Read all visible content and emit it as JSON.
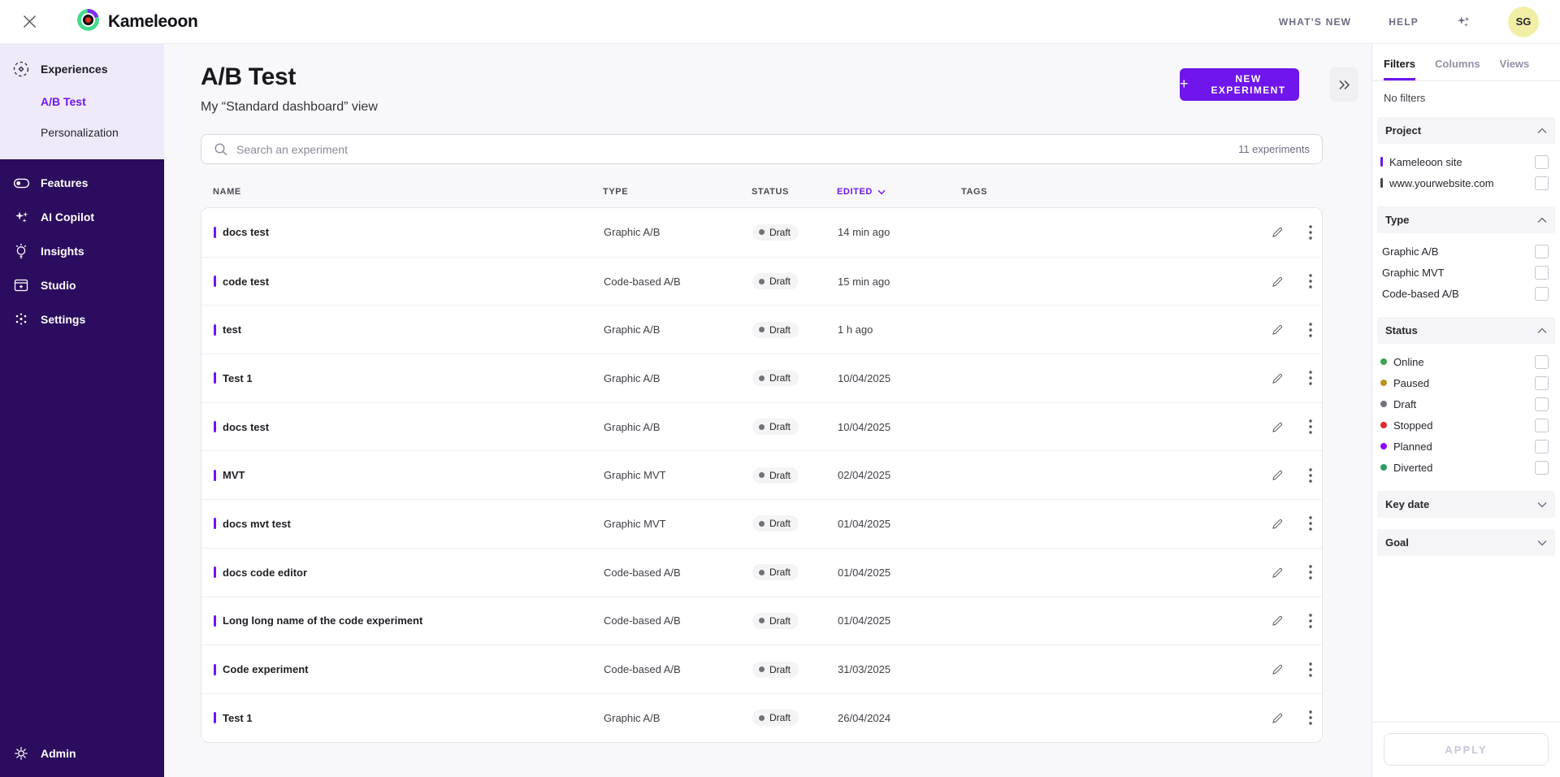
{
  "topbar": {
    "brand": "Kameleoon",
    "whats_new": "WHAT'S NEW",
    "help": "HELP",
    "avatar_initials": "SG"
  },
  "sidebar": {
    "experiences": {
      "label": "Experiences",
      "children": [
        {
          "label": "A/B Test",
          "active": true
        },
        {
          "label": "Personalization",
          "active": false
        }
      ]
    },
    "items": [
      {
        "label": "Features"
      },
      {
        "label": "AI Copilot"
      },
      {
        "label": "Insights"
      },
      {
        "label": "Studio"
      },
      {
        "label": "Settings"
      }
    ],
    "admin_label": "Admin"
  },
  "main": {
    "title": "A/B Test",
    "subtitle": "My “Standard dashboard” view",
    "new_experiment_label": "NEW EXPERIMENT",
    "search_placeholder": "Search an experiment",
    "experiments_count": "11 experiments",
    "table": {
      "columns": [
        "NAME",
        "TYPE",
        "STATUS",
        "EDITED",
        "TAGS"
      ],
      "rows": [
        {
          "name": "docs test",
          "type": "Graphic A/B",
          "status": "Draft",
          "edited": "14 min ago"
        },
        {
          "name": "code test",
          "type": "Code-based A/B",
          "status": "Draft",
          "edited": "15 min ago"
        },
        {
          "name": "test",
          "type": "Graphic A/B",
          "status": "Draft",
          "edited": "1 h ago"
        },
        {
          "name": "Test 1",
          "type": "Graphic A/B",
          "status": "Draft",
          "edited": "10/04/2025"
        },
        {
          "name": "docs test",
          "type": "Graphic A/B",
          "status": "Draft",
          "edited": "10/04/2025"
        },
        {
          "name": "MVT",
          "type": "Graphic MVT",
          "status": "Draft",
          "edited": "02/04/2025"
        },
        {
          "name": "docs mvt test",
          "type": "Graphic MVT",
          "status": "Draft",
          "edited": "01/04/2025"
        },
        {
          "name": "docs code editor",
          "type": "Code-based A/B",
          "status": "Draft",
          "edited": "01/04/2025"
        },
        {
          "name": "Long long name of the code experiment",
          "type": "Code-based A/B",
          "status": "Draft",
          "edited": "01/04/2025"
        },
        {
          "name": "Code experiment",
          "type": "Code-based A/B",
          "status": "Draft",
          "edited": "31/03/2025"
        },
        {
          "name": "Test 1",
          "type": "Graphic A/B",
          "status": "Draft",
          "edited": "26/04/2024"
        }
      ]
    }
  },
  "panel": {
    "tabs": [
      "Filters",
      "Columns",
      "Views"
    ],
    "no_filters": "No filters",
    "sections": {
      "project": {
        "title": "Project",
        "items": [
          {
            "label": "Kameleoon site",
            "bar_color": "#6E16EB"
          },
          {
            "label": "www.yourwebsite.com",
            "bar_color": "#44444C"
          }
        ]
      },
      "type": {
        "title": "Type",
        "items": [
          {
            "label": "Graphic A/B"
          },
          {
            "label": "Graphic MVT"
          },
          {
            "label": "Code-based A/B"
          }
        ]
      },
      "status": {
        "title": "Status",
        "items": [
          {
            "label": "Online",
            "dot_color": "#3EA34D"
          },
          {
            "label": "Paused",
            "dot_color": "#BE941E"
          },
          {
            "label": "Draft",
            "dot_color": "#71717A"
          },
          {
            "label": "Stopped",
            "dot_color": "#DD2B2B"
          },
          {
            "label": "Planned",
            "dot_color": "#8F00FF"
          },
          {
            "label": "Diverted",
            "dot_color": "#2D9B63"
          }
        ]
      },
      "key_date": {
        "title": "Key date"
      },
      "goal": {
        "title": "Goal"
      }
    },
    "apply_label": "APPLY"
  },
  "colors": {
    "accent": "#6E16EB",
    "sidebar_bg": "#2B0C5E",
    "sidebar_selected_bg": "#EFEAFA",
    "draft_dot": "#71717A",
    "status_pill_bg": "#F4F4F5"
  }
}
